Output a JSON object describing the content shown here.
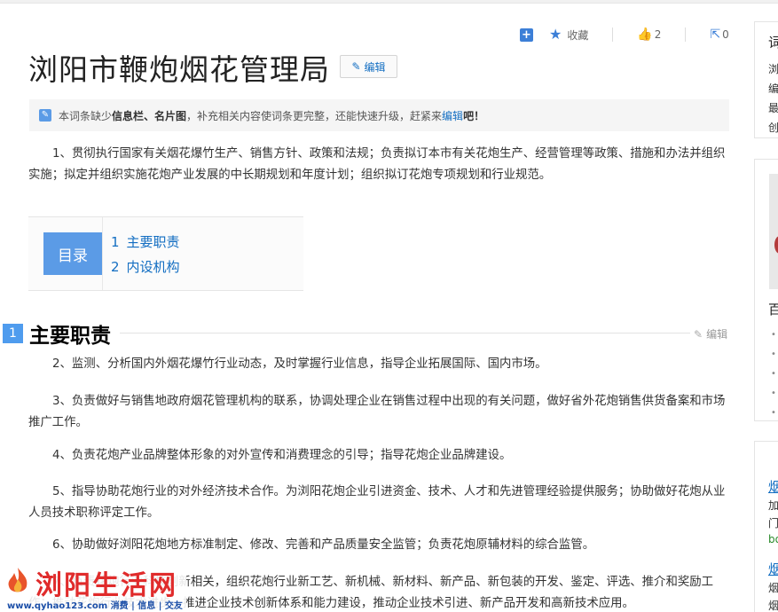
{
  "actions": {
    "plus_icon": "plus-square-icon",
    "favorite_label": "收藏",
    "like_count": "2",
    "share_count": "0"
  },
  "article": {
    "title": "浏阳市鞭炮烟花管理局",
    "edit_label": "编辑",
    "notice": {
      "prefix": "本词条缺少",
      "missing": "信息栏、名片图",
      "middle": "，补充相关内容使词条更完整，还能快速升级，赶紧来",
      "link": "编辑",
      "suffix": "吧！"
    },
    "intro": "1、贯彻执行国家有关烟花爆竹生产、销售方针、政策和法规；负责拟订本市有关花炮生产、经营管理等政策、措施和办法并组织实施；拟定并组织实施花炮产业发展的中长期规划和年度计划；组织拟订花炮专项规划和行业规范。"
  },
  "toc": {
    "label": "目录",
    "items": [
      {
        "num": "1",
        "label": "主要职责"
      },
      {
        "num": "2",
        "label": "内设机构"
      }
    ]
  },
  "section": {
    "num": "1",
    "title": "主要职责",
    "edit_label": "编辑",
    "paragraphs": [
      "2、监测、分析国内外烟花爆竹行业动态，及时掌握行业信息，指导企业拓展国际、国内市场。",
      "3、负责做好与销售地政府烟花管理机构的联系，协调处理企业在销售过程中出现的有关问题，做好省外花炮销售供货备案和市场推广工作。",
      "4、负责花炮产业品牌整体形象的对外宣传和消费理念的引导；指导花炮企业品牌建设。",
      "5、指导协助花炮行业的对外经济技术合作。为浏阳花炮企业引进资金、技术、人才和先进管理经验提供服务；协助做好花炮从业人员技术职称评定工作。",
      "6、协助做好浏阳花炮地方标准制定、修改、完善和产品质量安全监管；负责花炮原辅材料的综合监管。",
      "7、负责花炮行业科技创新相关，组织花炮行业新工艺、新机械、新材料、新产品、新包装的开发、鉴定、评选、推介和奖励工作；推动花炮行业技术进步，推进企业技术创新体系和能力建设，推动企业技术引进、新产品开发和高新技术应用。"
    ]
  },
  "watermark": {
    "brand": "浏阳生活网",
    "sub": "www.qyhao123.com 消费 | 信息 | 交友"
  },
  "sidebar": {
    "card1_lines": [
      "词",
      "浏",
      "编",
      "最",
      "创"
    ],
    "card2_head": "百",
    "card3_lines": [
      "烟",
      "加",
      "门",
      "bo",
      "烟",
      "烟",
      "烟"
    ]
  }
}
